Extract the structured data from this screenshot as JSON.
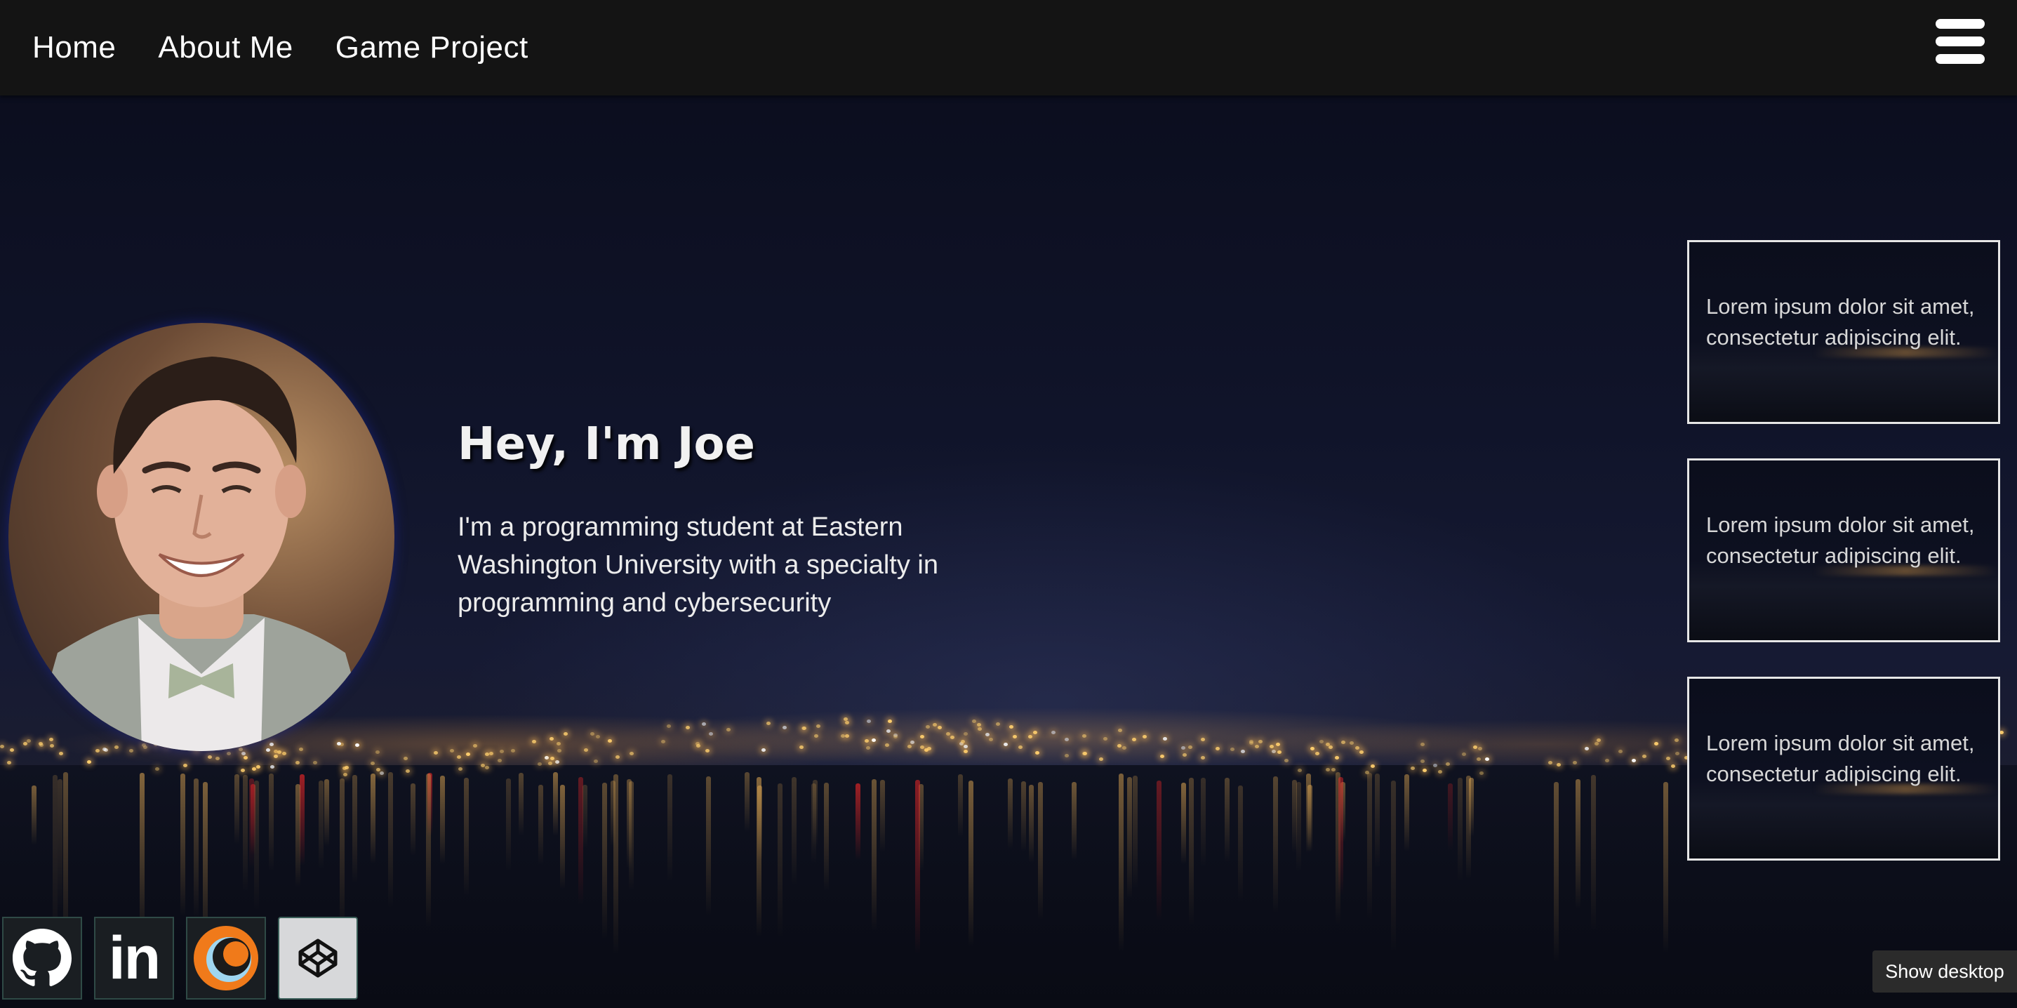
{
  "nav": {
    "links": [
      "Home",
      "About Me",
      "Game Project"
    ],
    "menu_icon": "hamburger-menu-icon"
  },
  "hero": {
    "title": "Hey, I'm Joe",
    "description": "I'm a programming student at Eastern Washington University with a specialty in programming and cybersecurity",
    "portrait": "portrait-photo"
  },
  "cards": [
    {
      "text": "Lorem ipsum dolor sit amet, consectetur adipiscing elit."
    },
    {
      "text": "Lorem ipsum dolor sit amet, consectetur adipiscing elit."
    },
    {
      "text": "Lorem ipsum dolor sit amet, consectetur adipiscing elit."
    }
  ],
  "socials": [
    {
      "icon": "github-icon"
    },
    {
      "icon": "linkedin-icon"
    },
    {
      "icon": "orange-ring-icon"
    },
    {
      "icon": "codepen-icon"
    }
  ],
  "linkedin_text": "in",
  "taskbar": {
    "show_desktop": "Show desktop"
  },
  "colors": {
    "navbar": "#141414",
    "background": "#0c0f1d",
    "card_border": "#e6e6e6",
    "city_lights": "#ffcf6e"
  }
}
